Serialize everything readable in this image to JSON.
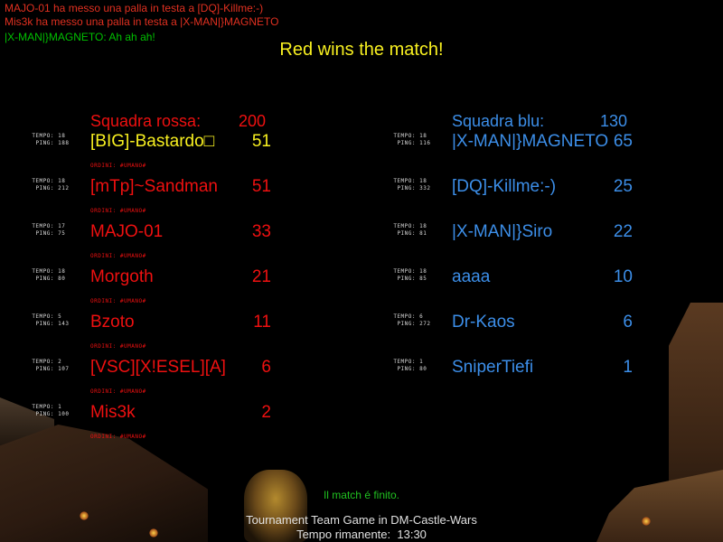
{
  "messages": [
    {
      "text": "MAJO-01 ha messo una palla in testa a [DQ]-Killme:-)"
    },
    {
      "text": "Mis3k ha messo una palla in testa a |X-MAN|}MAGNETO"
    }
  ],
  "chat": {
    "speaker": "|X-MAN|}MAGNETO:",
    "text": " Ah ah ah!"
  },
  "winner_text": "Red wins the match!",
  "stat_labels": {
    "time": "TEMPO:",
    "ping": "PING:"
  },
  "orders_label": "ORDINI:  #UMANO#",
  "red_team": {
    "name": "Squadra rossa:",
    "score": "200",
    "players": [
      {
        "name": "[BIG]-Bastardo□",
        "score": "51",
        "time": "18",
        "ping": "188"
      },
      {
        "name": "[mTp]~Sandman",
        "score": "51",
        "time": "18",
        "ping": "212"
      },
      {
        "name": "MAJO-01",
        "score": "33",
        "time": "17",
        "ping": "75"
      },
      {
        "name": "Morgoth",
        "score": "21",
        "time": "18",
        "ping": "80"
      },
      {
        "name": "Bzoto",
        "score": "11",
        "time": "5",
        "ping": "143"
      },
      {
        "name": "[VSC][X!ESEL][A]",
        "score": "6",
        "time": "2",
        "ping": "107"
      },
      {
        "name": "Mis3k",
        "score": "2",
        "time": "1",
        "ping": "100"
      }
    ]
  },
  "blue_team": {
    "name": "Squadra blu:",
    "score": "130",
    "players": [
      {
        "name": "|X-MAN|}MAGNETO",
        "score": "65",
        "time": "18",
        "ping": "116"
      },
      {
        "name": "[DQ]-Killme:-)",
        "score": "25",
        "time": "18",
        "ping": "332"
      },
      {
        "name": "|X-MAN|}Siro",
        "score": "22",
        "time": "18",
        "ping": "81"
      },
      {
        "name": "aaaa",
        "score": "10",
        "time": "18",
        "ping": "85"
      },
      {
        "name": "Dr-Kaos",
        "score": "6",
        "time": "6",
        "ping": "272"
      },
      {
        "name": "SniperTiefi",
        "score": "1",
        "time": "1",
        "ping": "80"
      }
    ]
  },
  "status_text": "Il match é finito.",
  "footer": {
    "game_line": "Tournament Team Game in DM-Castle-Wars",
    "time_label": "Tempo rimanente:",
    "time_value": "13:30"
  },
  "colors": {
    "red_team": "#ee1010",
    "blue_team": "#3c8ee8",
    "winner": "#f8f020",
    "status": "#20c020",
    "highlight_player": "#f8f020"
  }
}
